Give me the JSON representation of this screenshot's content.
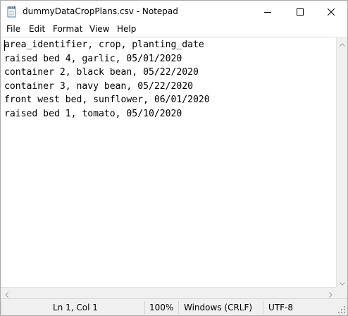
{
  "window": {
    "title": "dummyDataCropPlans.csv - Notepad",
    "icons": {
      "app": "notepad-icon",
      "minimize": "minimize-icon",
      "maximize": "maximize-icon",
      "close": "close-icon"
    }
  },
  "menu": {
    "items": [
      {
        "label": "File"
      },
      {
        "label": "Edit"
      },
      {
        "label": "Format"
      },
      {
        "label": "View"
      },
      {
        "label": "Help"
      }
    ]
  },
  "editor": {
    "lines": [
      "area_identifier, crop, planting_date",
      "raised bed 4, garlic, 05/01/2020",
      "container 2, black bean, 05/22/2020",
      "container 3, navy bean, 05/22/2020",
      "front west bed, sunflower, 06/01/2020",
      "raised bed 1, tomato, 05/10/2020"
    ]
  },
  "status": {
    "position": "Ln 1, Col 1",
    "zoom": "100%",
    "line_ending": "Windows (CRLF)",
    "encoding": "UTF-8"
  }
}
